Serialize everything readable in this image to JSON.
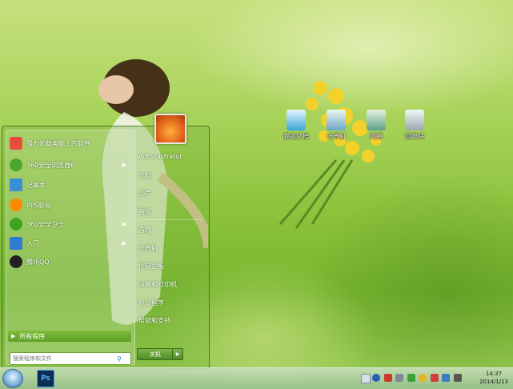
{
  "desktop": {
    "icons": [
      {
        "label": "我的文档",
        "icon": "documents-folder-icon",
        "color": "#3aa6d8"
      },
      {
        "label": "计算机",
        "icon": "computer-icon",
        "color": "#6aa6c8"
      },
      {
        "label": "网络",
        "icon": "network-icon",
        "color": "#5fa08a"
      },
      {
        "label": "回收站",
        "icon": "recycle-bin-icon",
        "color": "#9aa8b0"
      }
    ]
  },
  "start_menu": {
    "programs": [
      {
        "label": "强力卸载电脑上的软件",
        "icon": "uninstall-icon",
        "color": "#e94b3c",
        "submenu": false
      },
      {
        "label": "360安全浏览器6",
        "icon": "360-browser-icon",
        "color": "#4aa832",
        "submenu": true
      },
      {
        "label": "记事本",
        "icon": "notepad-icon",
        "color": "#3b8fd6",
        "submenu": false
      },
      {
        "label": "PPS影音",
        "icon": "pps-icon",
        "color": "#ff8a00",
        "submenu": false
      },
      {
        "label": "360安全卫士",
        "icon": "360-safe-icon",
        "color": "#3aa620",
        "submenu": true
      },
      {
        "label": "入门",
        "icon": "getting-started-icon",
        "color": "#2f7cd0",
        "submenu": true
      },
      {
        "label": "腾讯QQ",
        "icon": "qq-icon",
        "color": "#222222",
        "submenu": false
      }
    ],
    "all_programs": "所有程序",
    "search_placeholder": "搜索程序和文件",
    "right_items": [
      {
        "label": "Administrator"
      },
      {
        "label": "文档"
      },
      {
        "label": "图片"
      },
      {
        "label": "音乐"
      },
      {
        "label": "游戏"
      },
      {
        "label": "计算机"
      },
      {
        "label": "控制面板"
      },
      {
        "label": "设备和打印机"
      },
      {
        "label": "默认程序"
      },
      {
        "label": "帮助和支持"
      }
    ],
    "shutdown": "关机",
    "user_tile_icon": "flower-user-picture"
  },
  "taskbar": {
    "start_icon": "windows-start-orb",
    "pinned": [
      {
        "label": "Ps",
        "icon": "photoshop-icon"
      }
    ],
    "tray_icons": [
      "keyboard-icon",
      "help-icon",
      "flag-icon",
      "network-tray-icon",
      "volume-icon",
      "qq-tray-icon",
      "security-icon",
      "action-center-icon",
      "shield-tray-icon"
    ],
    "clock_time": "14:37",
    "clock_date": "2014/1/13"
  }
}
